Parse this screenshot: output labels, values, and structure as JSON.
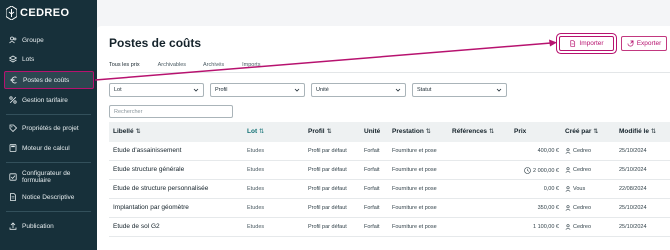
{
  "app": {
    "brand_text": "CEDREO"
  },
  "sidebar": {
    "items": [
      {
        "label": "Groupe",
        "icon": "users-icon"
      },
      {
        "label": "Lots",
        "icon": "layers-icon"
      },
      {
        "label": "Postes de coûts",
        "icon": "euro-icon",
        "active": true
      },
      {
        "label": "Gestion tarifaire",
        "icon": "percent-icon"
      },
      {
        "label": "Propriétés de projet",
        "icon": "tag-icon"
      },
      {
        "label": "Moteur de calcul",
        "icon": "calculator-icon"
      },
      {
        "label": "Configurateur de formulaire",
        "icon": "checkbox-icon"
      },
      {
        "label": "Notice Descriptive",
        "icon": "document-icon"
      },
      {
        "label": "Publication",
        "icon": "upload-icon"
      }
    ]
  },
  "page": {
    "title": "Postes de coûts"
  },
  "toolbar": {
    "import_label": "Importer",
    "export_label": "Exporter"
  },
  "tabs": [
    {
      "label": "Tous les prix",
      "active": true
    },
    {
      "label": "Archivables"
    },
    {
      "label": "Archivés"
    },
    {
      "label": "Imports"
    }
  ],
  "filters": {
    "lot": "Lot",
    "profil": "Profil",
    "unite": "Unité",
    "statut": "Statut"
  },
  "search": {
    "placeholder": "Rechercher"
  },
  "table": {
    "headers": {
      "libelle": "Libellé",
      "lot": "Lot",
      "profil": "Profil",
      "unite": "Unité",
      "prestation": "Prestation",
      "references": "Références",
      "prix": "Prix",
      "cree_par": "Créé par",
      "modifie_le": "Modifié le"
    },
    "rows": [
      {
        "libelle": "Etude d'assainissement",
        "lot": "Etudes",
        "profil": "Profil par défaut",
        "unite": "Forfait",
        "prestation": "Fourniture et pose",
        "prix": "400,00 €",
        "cree_par": "Cedreo",
        "modifie_le": "25/10/2024"
      },
      {
        "libelle": "Etude structure générale",
        "lot": "Etudes",
        "profil": "Profil par défaut",
        "unite": "Forfait",
        "prestation": "Fourniture et pose",
        "prix": "2 000,00 €",
        "cree_par": "Cedreo",
        "modifie_le": "25/10/2024",
        "clock": true
      },
      {
        "libelle": "Etude de structure personnalisée",
        "lot": "Etudes",
        "profil": "Profil par défaut",
        "unite": "Forfait",
        "prestation": "Fourniture et pose",
        "prix": "0,00 €",
        "cree_par": "Vous",
        "modifie_le": "22/08/2024"
      },
      {
        "libelle": "Implantation par géomètre",
        "lot": "Etudes",
        "profil": "Profil par défaut",
        "unite": "Forfait",
        "prestation": "Fourniture et pose",
        "prix": "350,00 €",
        "cree_par": "Cedreo",
        "modifie_le": "25/10/2024"
      },
      {
        "libelle": "Etude de sol G2",
        "lot": "Etudes",
        "profil": "Profil par défaut",
        "unite": "Forfait",
        "prestation": "Fourniture et pose",
        "prix": "1 100,00 €",
        "cree_par": "Cedreo",
        "modifie_le": "25/10/2024"
      }
    ]
  },
  "colors": {
    "sidebar_bg": "#17303a",
    "accent": "#b7126f",
    "teal": "#0c6e72"
  }
}
